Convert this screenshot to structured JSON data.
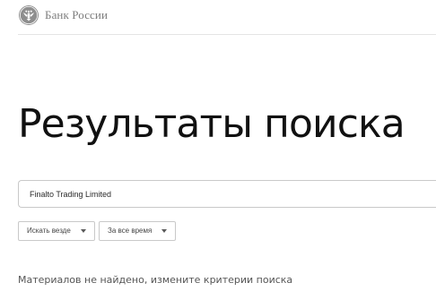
{
  "header": {
    "logo_text": "Банк России",
    "logo_icon": "double-headed-eagle-emblem-icon"
  },
  "page": {
    "title": "Результаты поиска"
  },
  "search": {
    "value": "Finalto Trading Limited"
  },
  "filters": [
    {
      "label": "Искать везде",
      "icon": "chevron-down-icon"
    },
    {
      "label": "За все время",
      "icon": "chevron-down-icon"
    }
  ],
  "results": {
    "message": "Материалов не найдено, измените критерии поиска"
  },
  "colors": {
    "logo_text": "#7d7d7d",
    "title": "#111111",
    "border": "#c9c9c9",
    "divider": "#e4e4e4",
    "muted_text": "#555555"
  }
}
